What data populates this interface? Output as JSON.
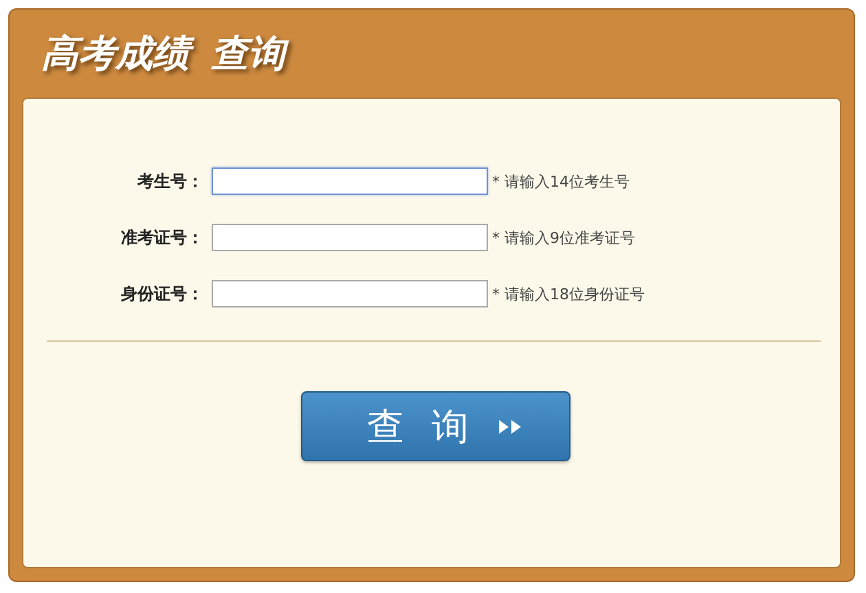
{
  "title": "高考成绩 查询",
  "fields": [
    {
      "label": "考生号：",
      "hint": "* 请输入14位考生号",
      "focused": true
    },
    {
      "label": "准考证号：",
      "hint": "* 请输入9位准考证号",
      "focused": false
    },
    {
      "label": "身份证号：",
      "hint": "* 请输入18位身份证号",
      "focused": false
    }
  ],
  "button": {
    "label": "查询"
  }
}
